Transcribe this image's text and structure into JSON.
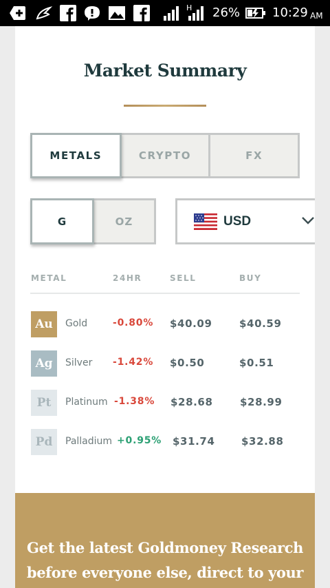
{
  "status_bar": {
    "battery_percent": "26%",
    "time": "10:29",
    "ampm": "AM",
    "network_label": "H",
    "icons": [
      "plus-square-icon",
      "feather-icon",
      "facebook-icon",
      "chat-bubble-icon",
      "image-icon",
      "facebook-icon",
      "signal-icon",
      "signal-h-icon",
      "battery-charging-icon"
    ]
  },
  "page": {
    "title": "Market Summary",
    "accent_color": "#bf9e63",
    "dark_text_color": "#1f3a3d"
  },
  "tabs": [
    {
      "label": "METALS",
      "active": true
    },
    {
      "label": "CRYPTO",
      "active": false
    },
    {
      "label": "FX",
      "active": false
    }
  ],
  "unit_toggle": [
    {
      "label": "G",
      "active": true
    },
    {
      "label": "OZ",
      "active": false
    }
  ],
  "currency": {
    "selected": "USD",
    "flag_icon": "us-flag-icon"
  },
  "table": {
    "columns": [
      "METAL",
      "24HR",
      "SELL",
      "BUY"
    ],
    "rows": [
      {
        "symbol": "Au",
        "name": "Gold",
        "change": "-0.80%",
        "sell": "$40.09",
        "buy": "$40.59",
        "badge_color": "#bf9e63",
        "direction": "down"
      },
      {
        "symbol": "Ag",
        "name": "Silver",
        "change": "-1.42%",
        "sell": "$0.50",
        "buy": "$0.51",
        "badge_color": "#a9bcc3",
        "direction": "down"
      },
      {
        "symbol": "Pt",
        "name": "Platinum",
        "change": "-1.38%",
        "sell": "$28.68",
        "buy": "$28.99",
        "badge_color": "#e2e8eb",
        "direction": "down"
      },
      {
        "symbol": "Pd",
        "name": "Palladium",
        "change": "+0.95%",
        "sell": "$31.74",
        "buy": "$32.88",
        "badge_color": "#e2e8eb",
        "direction": "up"
      }
    ]
  },
  "promo": {
    "line1": "Get the latest Goldmoney Research",
    "line2": "before everyone else, direct to your"
  }
}
